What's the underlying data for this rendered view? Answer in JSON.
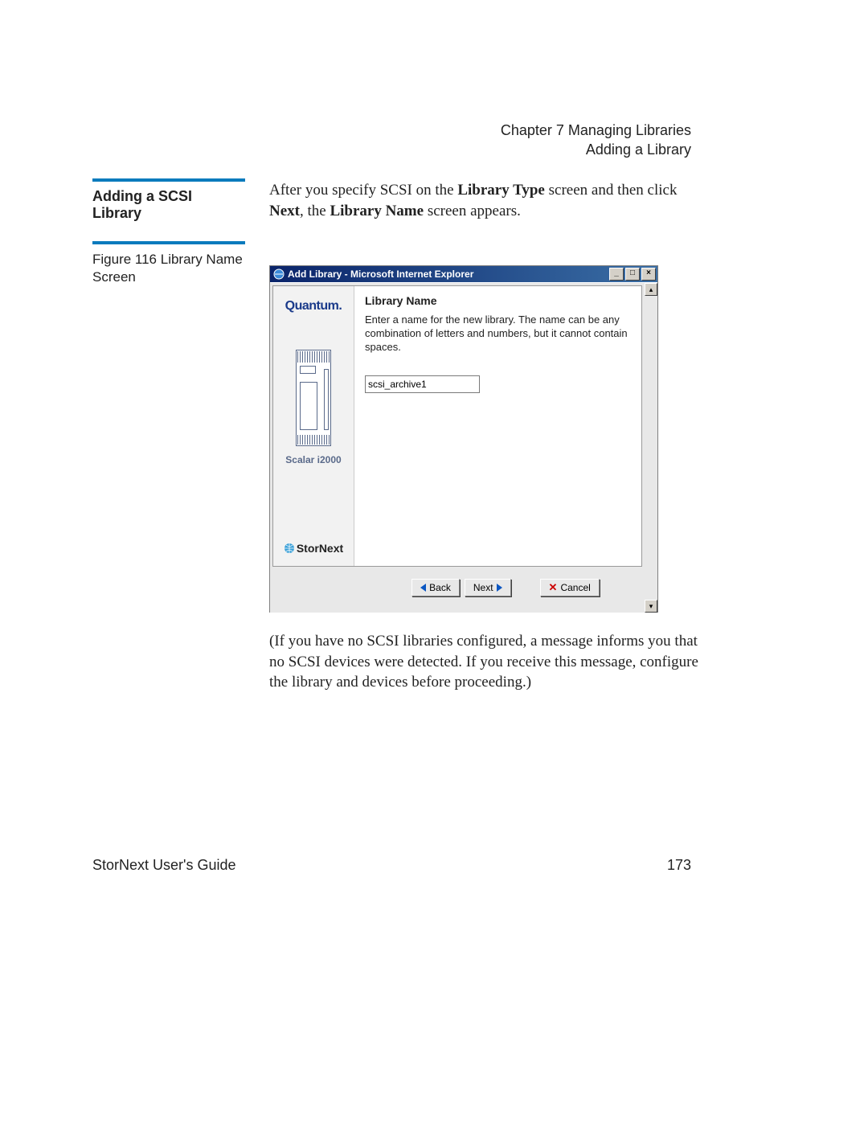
{
  "header": {
    "chapter": "Chapter 7  Managing Libraries",
    "section": "Adding a Library"
  },
  "section_title": "Adding a SCSI Library",
  "intro": {
    "pre": "After you specify SCSI on the ",
    "bold1": "Library Type",
    "mid1": " screen and then click ",
    "bold2": "Next",
    "mid2": ", the ",
    "bold3": "Library Name",
    "post": " screen appears."
  },
  "figure_caption": "Figure 116  Library Name Screen",
  "screenshot": {
    "title": "Add Library - Microsoft Internet Explorer",
    "sidebar": {
      "brand": "Quantum.",
      "device_label": "Scalar i2000",
      "product": "StorNext"
    },
    "pane": {
      "title": "Library Name",
      "desc": "Enter a name for the new library. The name can be any combination of letters and numbers, but it cannot contain spaces.",
      "input_value": "scsi_archive1"
    },
    "buttons": {
      "back": "Back",
      "next": "Next",
      "cancel": "Cancel"
    }
  },
  "post_text": "(If you have no SCSI libraries configured, a message informs you that no SCSI devices were detected. If you receive this message, configure the library and devices before proceeding.)",
  "footer": {
    "left": "StorNext User's Guide",
    "right": "173"
  }
}
